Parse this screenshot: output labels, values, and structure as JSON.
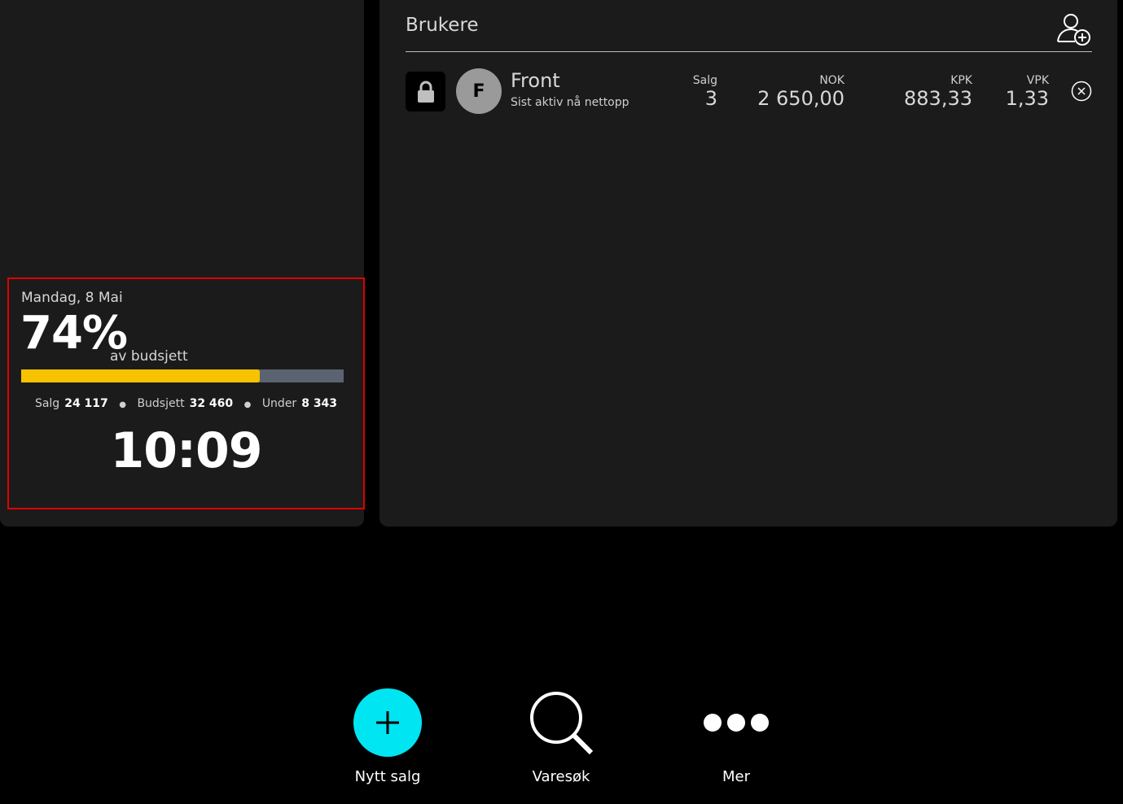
{
  "budget": {
    "date": "Mandag, 8 Mai",
    "percent": "74%",
    "percent_label": "av budsjett",
    "progress_fraction": 0.74,
    "stats": {
      "sales_label": "Salg",
      "sales_value": "24 117",
      "budget_label": "Budsjett",
      "budget_value": "32 460",
      "under_label": "Under",
      "under_value": "8 343"
    },
    "time": "10:09"
  },
  "users": {
    "title": "Brukere",
    "rows": [
      {
        "initial": "F",
        "name": "Front",
        "status": "Sist aktiv nå nettopp",
        "sales_label": "Salg",
        "sales_value": "3",
        "nok_label": "NOK",
        "nok_value": "2 650,00",
        "kpk_label": "KPK",
        "kpk_value": "883,33",
        "vpk_label": "VPK",
        "vpk_value": "1,33"
      }
    ]
  },
  "actions": {
    "new_sale": "Nytt salg",
    "search": "Varesøk",
    "more": "Mer"
  },
  "colors": {
    "accent": "#00e5f2",
    "progress_fill": "#f7c300",
    "progress_track": "#5b6270",
    "panel": "#1b1b1b"
  }
}
